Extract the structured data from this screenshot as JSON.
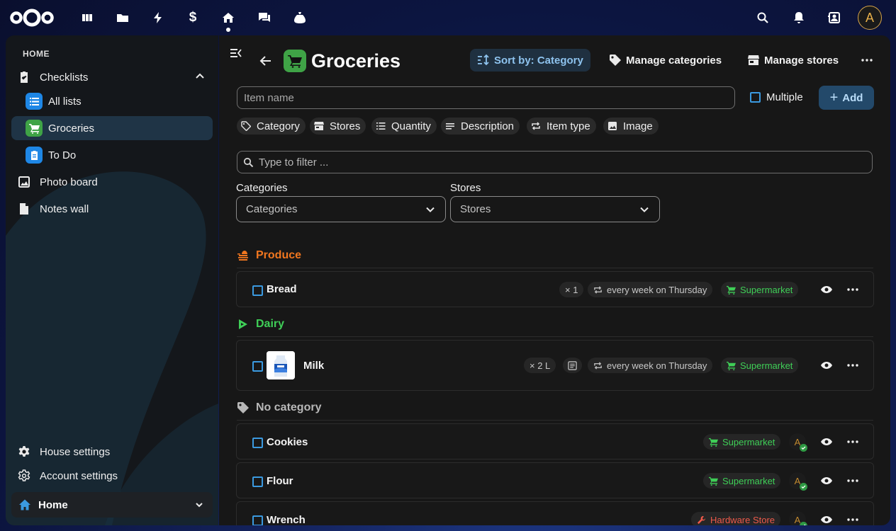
{
  "topbar": {
    "apps": [
      {
        "icon": "dashboard-icon"
      },
      {
        "icon": "files-icon"
      },
      {
        "icon": "activity-icon"
      },
      {
        "icon": "money-icon"
      },
      {
        "icon": "house-icon"
      },
      {
        "icon": "talk-icon"
      },
      {
        "icon": "cospend-icon"
      }
    ],
    "avatar_initial": "A"
  },
  "sidebar": {
    "caption": "HOME",
    "checklists_label": "Checklists",
    "lists": [
      {
        "label": "All lists",
        "color": "#1e87e6"
      },
      {
        "label": "Groceries",
        "color": "#3fa346"
      },
      {
        "label": "To Do",
        "color": "#1e87e6"
      }
    ],
    "photo_board": "Photo board",
    "notes_wall": "Notes wall",
    "house_settings": "House settings",
    "account_settings": "Account settings",
    "home_switch": "Home"
  },
  "main": {
    "title": "Groceries",
    "sort_label": "Sort by: Category",
    "manage_categories": "Manage categories",
    "manage_stores": "Manage stores",
    "item_placeholder": "Item name",
    "multiple_label": "Multiple",
    "add_label": "Add",
    "chips": [
      "Category",
      "Stores",
      "Quantity",
      "Description",
      "Item type",
      "Image"
    ],
    "filter_placeholder": "Type to filter ...",
    "categories_label": "Categories",
    "categories_value": "Categories",
    "stores_label": "Stores",
    "stores_value": "Stores"
  },
  "groups": [
    {
      "name": "Produce",
      "color": "#f0761f"
    },
    {
      "name": "Dairy",
      "color": "#3fcf57"
    },
    {
      "name": "No category",
      "color": "#b8b8b8"
    }
  ],
  "items": {
    "bread": {
      "name": "Bread",
      "qty": "× 1",
      "repeat": "every week on Thursday",
      "store": "Supermarket"
    },
    "milk": {
      "name": "Milk",
      "qty": "× 2 L",
      "repeat": "every week on Thursday",
      "store": "Supermarket"
    },
    "cookies": {
      "name": "Cookies",
      "store": "Supermarket",
      "avatar": "A"
    },
    "flour": {
      "name": "Flour",
      "store": "Supermarket",
      "avatar": "A"
    },
    "wrench": {
      "name": "Wrench",
      "store": "Hardware Store",
      "avatar": "A"
    }
  },
  "colors": {
    "accent": "#3b9ae0",
    "store_green": "#3fcf57",
    "hardware_red": "#ef5a4a",
    "produce_orange": "#f0761f"
  }
}
